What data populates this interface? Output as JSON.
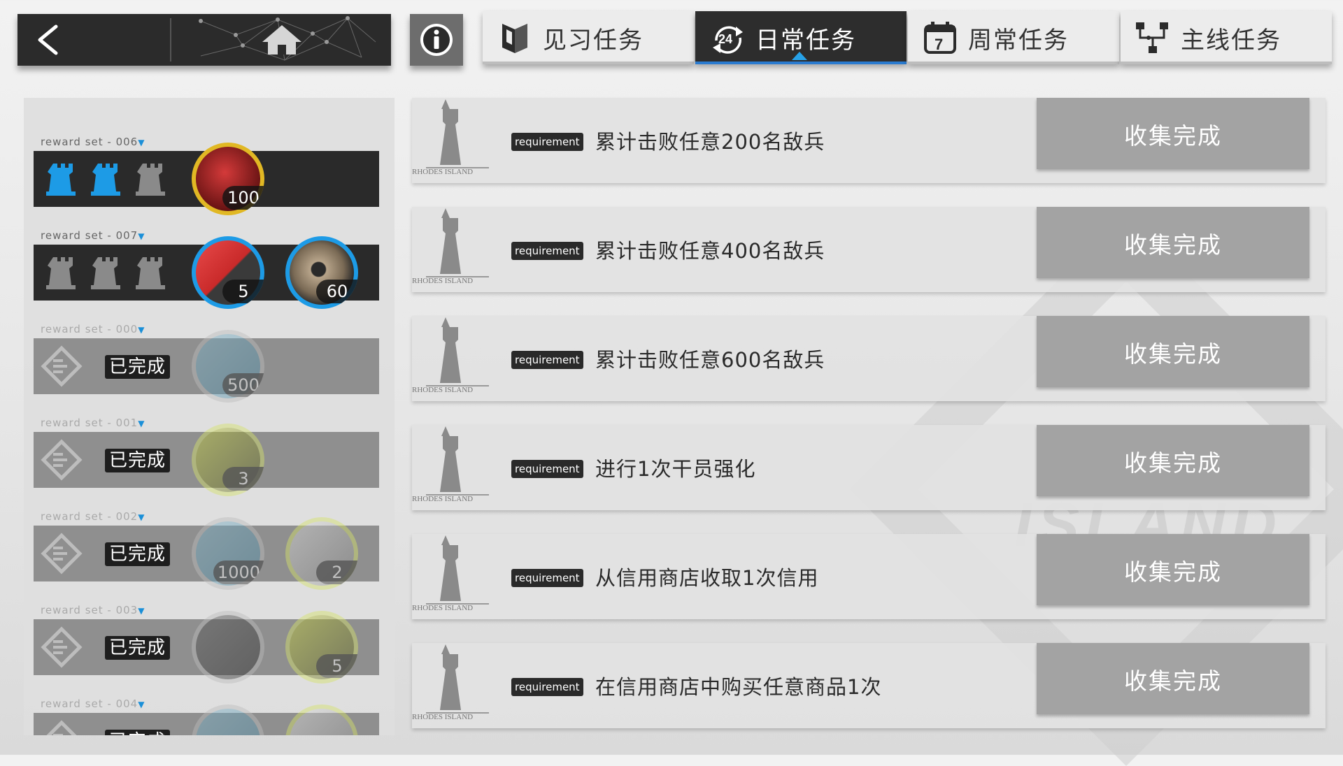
{
  "nav": {
    "back_icon": "back-arrow-icon",
    "home_icon": "home-icon",
    "info_icon": "info-icon"
  },
  "tabs": [
    {
      "label": "见习任务",
      "icon": "shield-book-icon",
      "active": false
    },
    {
      "label": "日常任务",
      "icon": "24h-refresh-icon",
      "active": true
    },
    {
      "label": "周常任务",
      "icon": "calendar-7-icon",
      "active": false
    },
    {
      "label": "主线任务",
      "icon": "flowchart-icon",
      "active": false
    }
  ],
  "reward_sets": [
    {
      "label": "reward set - 006",
      "completed": false,
      "rewards": [
        {
          "name": "exp-card-icon",
          "qty": "100"
        }
      ]
    },
    {
      "label": "reward set - 007",
      "completed": false,
      "rewards": [
        {
          "name": "purchase-certificate-icon",
          "qty": "5"
        },
        {
          "name": "hex-nut-icon",
          "qty": "60"
        }
      ]
    },
    {
      "label": "reward set - 000",
      "completed": true,
      "done_text": "已完成",
      "rewards": [
        {
          "name": "lmd-icon",
          "qty": "500"
        }
      ]
    },
    {
      "label": "reward set - 001",
      "completed": true,
      "done_text": "已完成",
      "rewards": [
        {
          "name": "battle-record-icon",
          "qty": "3"
        }
      ]
    },
    {
      "label": "reward set - 002",
      "completed": true,
      "done_text": "已完成",
      "rewards": [
        {
          "name": "lmd-icon",
          "qty": "1000"
        },
        {
          "name": "gadget-icon",
          "qty": "2"
        }
      ]
    },
    {
      "label": "reward set - 003",
      "completed": true,
      "done_text": "已完成",
      "rewards": [
        {
          "name": "box-icon",
          "qty": ""
        },
        {
          "name": "battle-record-icon",
          "qty": "5"
        }
      ]
    },
    {
      "label": "reward set - 004",
      "completed": true,
      "done_text": "已完成",
      "rewards": [
        {
          "name": "lmd-icon",
          "qty": ""
        },
        {
          "name": "gadget-icon",
          "qty": ""
        }
      ]
    }
  ],
  "tasks": [
    {
      "tag": "requirement",
      "text": "累计击败任意200名敌兵",
      "button": "收集完成",
      "logo_text": "RHODES ISLAND"
    },
    {
      "tag": "requirement",
      "text": "累计击败任意400名敌兵",
      "button": "收集完成",
      "logo_text": "RHODES ISLAND"
    },
    {
      "tag": "requirement",
      "text": "累计击败任意600名敌兵",
      "button": "收集完成",
      "logo_text": "RHODES ISLAND"
    },
    {
      "tag": "requirement",
      "text": "进行1次干员强化",
      "button": "收集完成",
      "logo_text": "RHODES ISLAND"
    },
    {
      "tag": "requirement",
      "text": "从信用商店收取1次信用",
      "button": "收集完成",
      "logo_text": "RHODES ISLAND"
    },
    {
      "tag": "requirement",
      "text": "在信用商店中购买任意商品1次",
      "button": "收集完成",
      "logo_text": "RHODES ISLAND"
    }
  ],
  "colors": {
    "accent": "#27a2e8",
    "dark": "#2a2a2a",
    "button": "#a3a3a3"
  }
}
